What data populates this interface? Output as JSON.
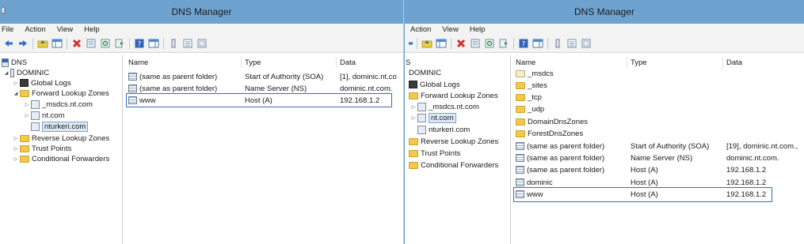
{
  "left": {
    "title": "DNS Manager",
    "menu": [
      "File",
      "Action",
      "View",
      "Help"
    ],
    "tree": [
      {
        "label": "DNS",
        "icon": "dns-icon",
        "expander": ""
      },
      {
        "label": "DOMINIC",
        "icon": "server-icon",
        "expander": "◢"
      },
      {
        "label": "Global Logs",
        "icon": "logs-icon",
        "expander": "▷"
      },
      {
        "label": "Forward Lookup Zones",
        "icon": "folder-icon",
        "expander": "◢"
      },
      {
        "label": "_msdcs.nt.com",
        "icon": "zone-icon",
        "expander": "▷"
      },
      {
        "label": "nt.com",
        "icon": "zone-icon",
        "expander": "▷"
      },
      {
        "label": "nturkeri.com",
        "icon": "zone-icon",
        "expander": "",
        "selected": true
      },
      {
        "label": "Reverse Lookup Zones",
        "icon": "folder-icon",
        "expander": "▷"
      },
      {
        "label": "Trust Points",
        "icon": "folder-icon",
        "expander": "▷"
      },
      {
        "label": "Conditional Forwarders",
        "icon": "folder-icon",
        "expander": "▷"
      }
    ],
    "columns": [
      "Name",
      "Type",
      "Data"
    ],
    "rows": [
      {
        "name": "(same as parent folder)",
        "type": "Start of Authority (SOA)",
        "data": "[1], dominic.nt.co"
      },
      {
        "name": "(same as parent folder)",
        "type": "Name Server (NS)",
        "data": "dominic.nt.com."
      },
      {
        "name": "www",
        "type": "Host (A)",
        "data": "192.168.1.2",
        "highlighted": true
      }
    ]
  },
  "right": {
    "title": "DNS Manager",
    "menu": [
      "Action",
      "View",
      "Help"
    ],
    "tree": [
      {
        "label": "S",
        "icon": "",
        "expander": ""
      },
      {
        "label": "DOMINIC",
        "icon": "",
        "expander": ""
      },
      {
        "label": "Global Logs",
        "icon": "logs-icon",
        "expander": ""
      },
      {
        "label": "Forward Lookup Zones",
        "icon": "folder-icon",
        "expander": ""
      },
      {
        "label": "_msdcs.nt.com",
        "icon": "zone-icon",
        "expander": "▷"
      },
      {
        "label": "nt.com",
        "icon": "zone-icon",
        "expander": "▷",
        "selected": true
      },
      {
        "label": "nturkeri.com",
        "icon": "zone-icon",
        "expander": ""
      },
      {
        "label": "Reverse Lookup Zones",
        "icon": "folder-icon",
        "expander": ""
      },
      {
        "label": "Trust Points",
        "icon": "folder-icon",
        "expander": ""
      },
      {
        "label": "Conditional Forwarders",
        "icon": "folder-icon",
        "expander": ""
      }
    ],
    "columns": [
      "Name",
      "Type",
      "Data"
    ],
    "rows": [
      {
        "name": "_msdcs",
        "type": "",
        "data": "",
        "icon": "folder-icon"
      },
      {
        "name": "_sites",
        "type": "",
        "data": "",
        "icon": "folder-icon"
      },
      {
        "name": "_tcp",
        "type": "",
        "data": "",
        "icon": "folder-icon"
      },
      {
        "name": "_udp",
        "type": "",
        "data": "",
        "icon": "folder-icon"
      },
      {
        "name": "DomainDnsZones",
        "type": "",
        "data": "",
        "icon": "folder-icon"
      },
      {
        "name": "ForestDnsZones",
        "type": "",
        "data": "",
        "icon": "folder-icon"
      },
      {
        "name": "(same as parent folder)",
        "type": "Start of Authority (SOA)",
        "data": "[19], dominic.nt.com.,",
        "icon": "record-icon"
      },
      {
        "name": "(same as parent folder)",
        "type": "Name Server (NS)",
        "data": "dominic.nt.com.",
        "icon": "record-icon"
      },
      {
        "name": "(same as parent folder)",
        "type": "Host (A)",
        "data": "192.168.1.2",
        "icon": "record-icon"
      },
      {
        "name": "dominic",
        "type": "Host (A)",
        "data": "192.168.1.2",
        "icon": "record-icon"
      },
      {
        "name": "www",
        "type": "Host (A)",
        "data": "192.168.1.2",
        "icon": "record-icon",
        "highlighted": true
      }
    ]
  },
  "colors": {
    "titlebar": "#6fa3cf",
    "selection": "#dde9f5",
    "highlight_box": "#2d6fc0",
    "folder": "#f0c94d"
  }
}
